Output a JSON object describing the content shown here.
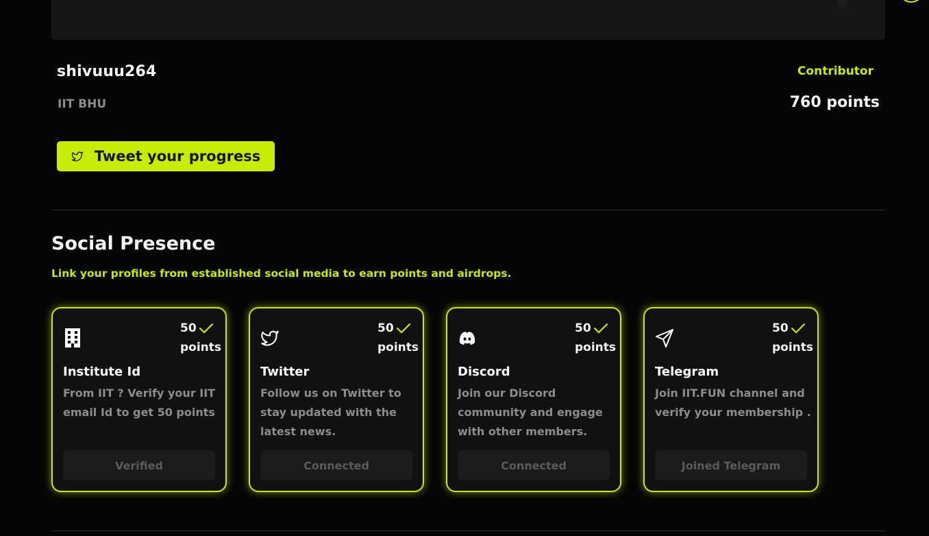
{
  "profile": {
    "username": "shivuuu264",
    "institute": "IIT BHU",
    "rank": "Contributor",
    "points": "760 points",
    "tweet_button_label": "Tweet your progress"
  },
  "social": {
    "title": "Social Presence",
    "subtitle": "Link your profiles from established social media to earn points and airdrops.",
    "cards": [
      {
        "icon": "building-icon",
        "points": "50",
        "points_unit": "points",
        "title": "Institute Id",
        "description": "From IIT ? Verify your IIT email Id to get 50 points",
        "action_label": "Verified"
      },
      {
        "icon": "twitter-icon",
        "points": "50",
        "points_unit": "points",
        "title": "Twitter",
        "description": "Follow us on Twitter to stay updated with the latest news.",
        "action_label": "Connected"
      },
      {
        "icon": "discord-icon",
        "points": "50",
        "points_unit": "points",
        "title": "Discord",
        "description": "Join our Discord community and engage with other members.",
        "action_label": "Connected"
      },
      {
        "icon": "send-icon",
        "points": "50",
        "points_unit": "points",
        "title": "Telegram",
        "description": "Join IIT.FUN channel and verify your membership .",
        "action_label": "Joined Telegram"
      }
    ]
  },
  "colors": {
    "accent": "#c6ec00",
    "background": "#050505",
    "card_background": "#111111",
    "muted_text": "#8c8c8c"
  }
}
